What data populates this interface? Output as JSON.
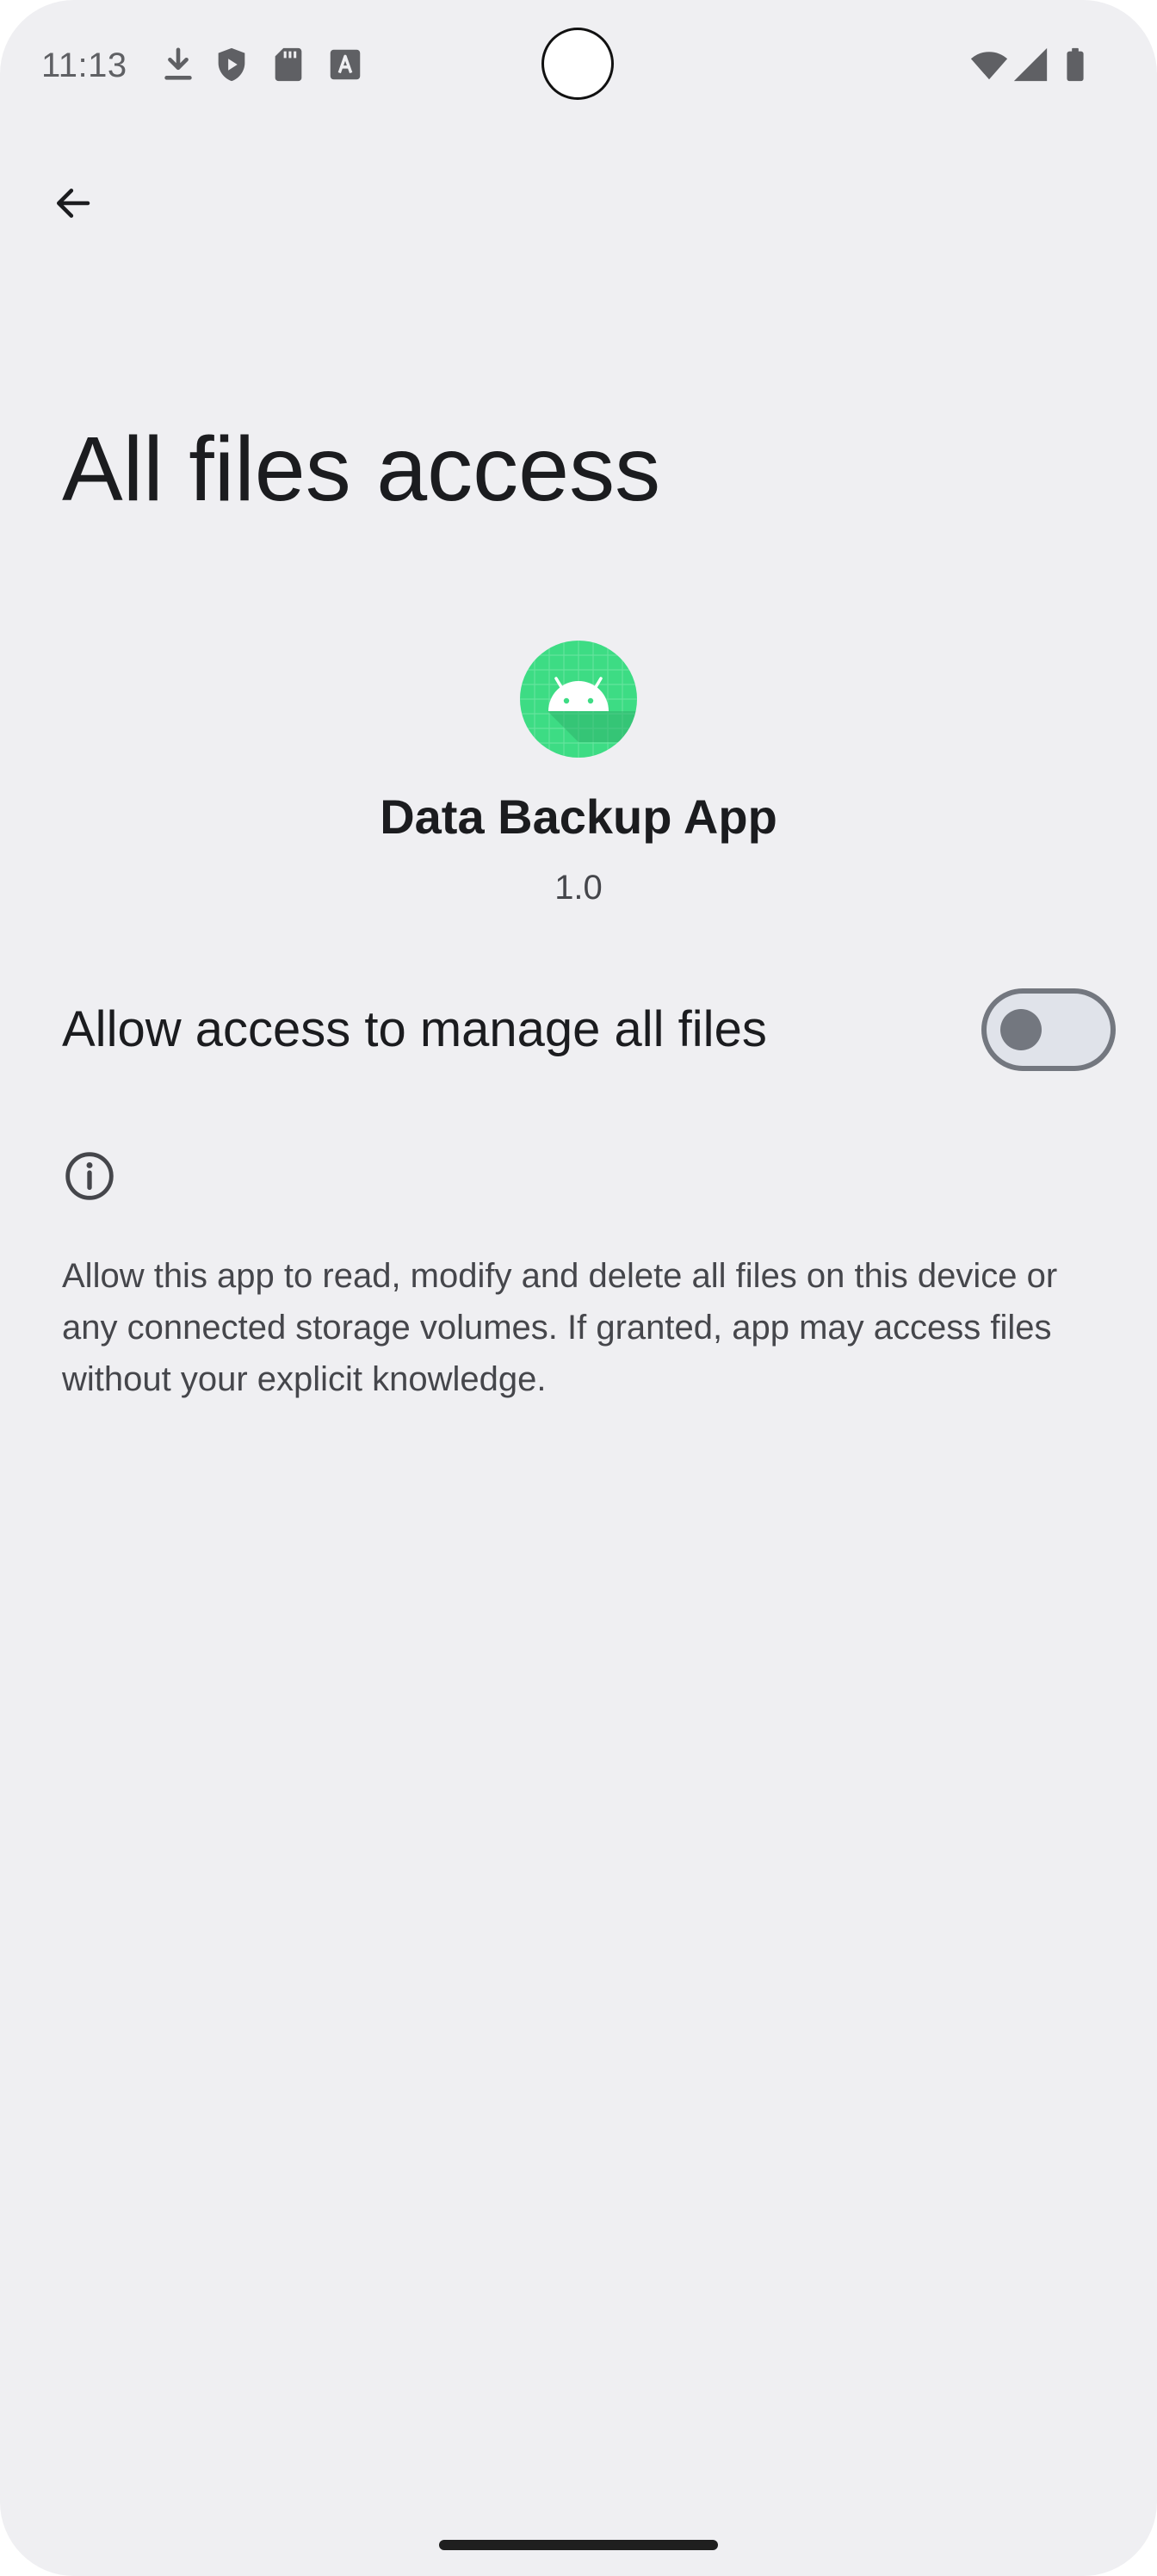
{
  "status_bar": {
    "time": "11:13",
    "left_icons": [
      "download-icon",
      "shield-play-icon",
      "sd-card-icon",
      "font-a-icon"
    ],
    "right_icons": [
      "wifi-icon",
      "cellular-signal-icon",
      "battery-icon"
    ]
  },
  "toolbar": {
    "back_icon": "arrow-back-icon"
  },
  "page": {
    "title": "All files access"
  },
  "app": {
    "name": "Data Backup App",
    "version": "1.0",
    "icon": "android-app-icon",
    "icon_color": "#3ddc84"
  },
  "permission": {
    "label": "Allow access to manage all files",
    "enabled": false
  },
  "info": {
    "icon": "info-icon",
    "text": "Allow this app to read, modify and delete all files on this device or any connected storage volumes. If granted, app may access files without your explicit knowledge."
  },
  "colors": {
    "background": "#efeff2",
    "primary_text": "#1b1c1f",
    "secondary_text": "#45464b",
    "switch_outline": "#73777f",
    "switch_track": "#e0e3ea"
  }
}
